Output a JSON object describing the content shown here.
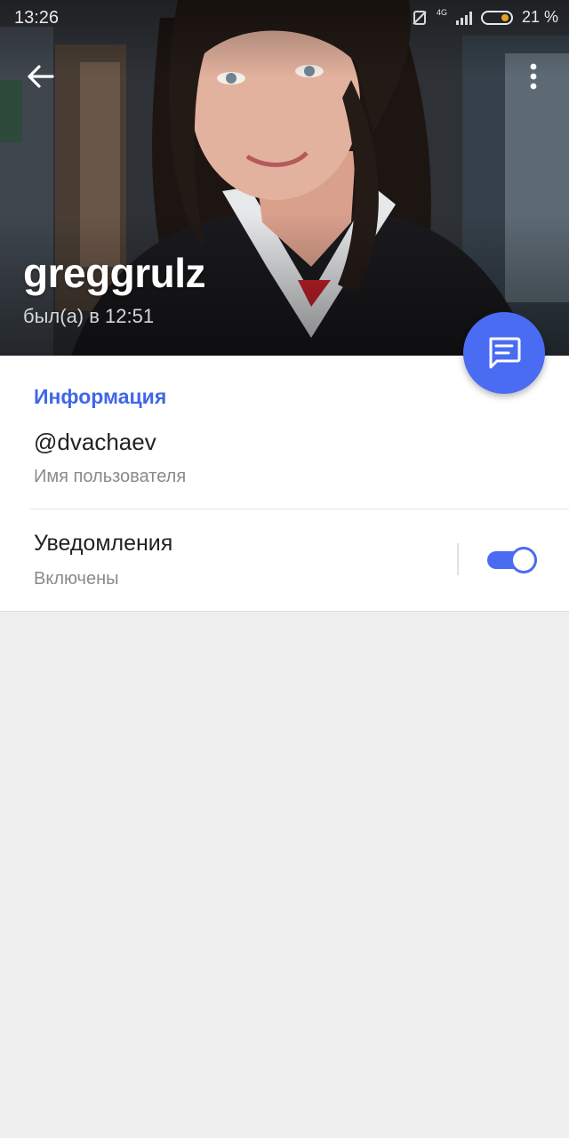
{
  "status_bar": {
    "time": "13:26",
    "network": "4G",
    "battery": "21 %"
  },
  "header": {
    "back_icon": "arrow-left-icon",
    "menu_icon": "more-vertical-icon",
    "name": "greggrulz",
    "last_seen": "был(а) в 12:51"
  },
  "fab": {
    "icon": "message-icon"
  },
  "info": {
    "section_title": "Информация",
    "username": "@dvachaev",
    "username_caption": "Имя пользователя",
    "notifications_label": "Уведомления",
    "notifications_status": "Включены",
    "notifications_enabled": true
  },
  "colors": {
    "accent": "#4a6cf2",
    "section_title": "#4167e6",
    "background": "#efefef"
  }
}
